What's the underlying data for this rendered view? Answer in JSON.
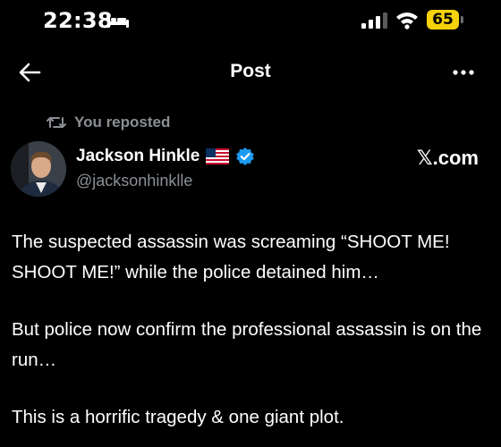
{
  "status_bar": {
    "time": "22:38",
    "battery_level": "65",
    "battery_color": "#f5d20b",
    "icons": [
      "bed-icon",
      "cellular-signal-icon",
      "wifi-icon",
      "battery-icon"
    ]
  },
  "nav": {
    "title": "Post",
    "back_icon": "arrow-left-icon",
    "more_icon": "more-horizontal-icon"
  },
  "repost": {
    "icon": "repost-icon",
    "text": "You reposted"
  },
  "author": {
    "name": "Jackson Hinkle",
    "flag_icon": "us-flag-icon",
    "verified_icon": "verified-badge-icon",
    "verified_color": "#1d9bf0",
    "handle": "@jacksonhinklle",
    "source": "𝕏.com"
  },
  "post": {
    "paragraphs": [
      "The suspected assassin was screaming “SHOOT ME! SHOOT ME!” while the police detained him…",
      "But police now confirm the professional assassin is on the run…",
      "This is a horrific tragedy & one giant plot."
    ]
  }
}
